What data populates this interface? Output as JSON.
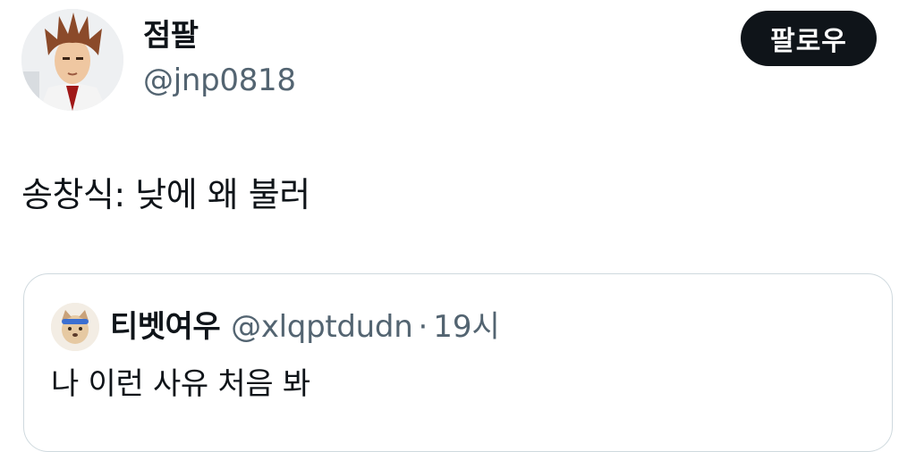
{
  "author": {
    "display_name": "점팔",
    "handle": "@jnp0818",
    "avatar_icon": "anime-character-avatar"
  },
  "follow_button": {
    "label": "팔로우",
    "bg_color": "#0f1419",
    "text_color": "#ffffff"
  },
  "tweet": {
    "text": "송창식: 낮에 왜 불러"
  },
  "quoted_tweet": {
    "display_name": "티벳여우",
    "handle": "@xlqptdudn",
    "separator": "·",
    "time": "19시",
    "text": "나 이런 사유 처음 봐",
    "avatar_icon": "fox-avatar"
  },
  "colors": {
    "text": "#0f1419",
    "secondary": "#536471",
    "border": "#cfd9de"
  }
}
